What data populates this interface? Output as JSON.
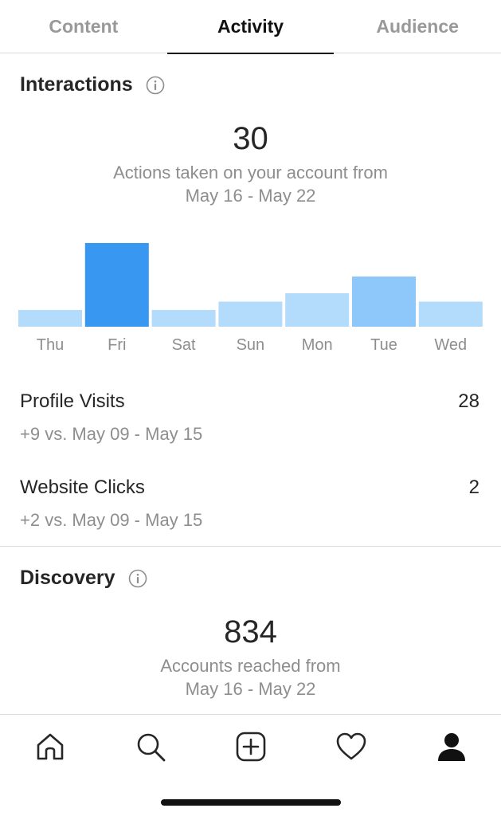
{
  "tabs": [
    {
      "label": "Content",
      "active": false
    },
    {
      "label": "Activity",
      "active": true
    },
    {
      "label": "Audience",
      "active": false
    }
  ],
  "interactions": {
    "title": "Interactions",
    "total": "30",
    "caption_line1": "Actions taken on your account from",
    "caption_line2": "May 16 - May 22",
    "profile_visits": {
      "label": "Profile Visits",
      "value": "28",
      "sub": "+9 vs. May 09 - May 15"
    },
    "website_clicks": {
      "label": "Website Clicks",
      "value": "2",
      "sub": "+2 vs. May 09 - May 15"
    }
  },
  "discovery": {
    "title": "Discovery",
    "total": "834",
    "caption_line1": "Accounts reached from",
    "caption_line2": "May 16 - May 22"
  },
  "chart_data": {
    "type": "bar",
    "categories": [
      "Thu",
      "Fri",
      "Sat",
      "Sun",
      "Mon",
      "Tue",
      "Wed"
    ],
    "values": [
      2,
      10,
      2,
      3,
      4,
      6,
      3
    ],
    "ylim": [
      0,
      10
    ],
    "highlight_index": 1,
    "colors": {
      "normal": "#b3dbfb",
      "highlight": "#3897f0",
      "secondary": "#8ec8fb",
      "label": "#8e8e8e"
    }
  },
  "nav": {
    "icons": [
      "home-icon",
      "search-icon",
      "add-post-icon",
      "activity-heart-icon",
      "profile-icon"
    ]
  }
}
